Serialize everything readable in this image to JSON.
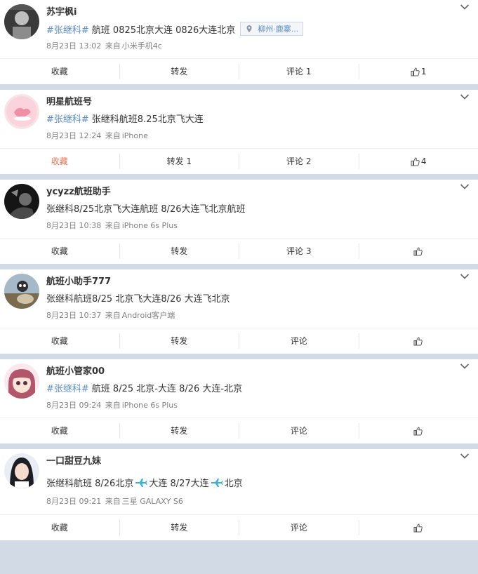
{
  "posts": [
    {
      "username": "苏宇枫i",
      "topic": "#张继科#",
      "text": "航班 0825北京大连 0826大连北京",
      "location": "柳州·鹿寨...",
      "time": "8月23日 13:02",
      "source_prefix": "来自",
      "source": "小米手机4c",
      "actions": {
        "fav": "收藏",
        "repost": "转发",
        "comment": "评论 1",
        "like": "1"
      }
    },
    {
      "username": "明星航班号",
      "topic": "#张继科#",
      "text": "张继科航班8.25北京飞大连",
      "time": "8月23日 12:24",
      "source_prefix": "来自",
      "source": "iPhone",
      "actions": {
        "fav": "收藏",
        "repost": "转发 1",
        "comment": "评论 2",
        "like": "4"
      },
      "fav_active": true
    },
    {
      "username": "ycyzz航班助手",
      "text": "张继科8/25北京飞大连航班 8/26大连飞北京航班",
      "time": "8月23日 10:38",
      "source_prefix": "来自",
      "source": "iPhone 6s Plus",
      "actions": {
        "fav": "收藏",
        "repost": "转发",
        "comment": "评论 3",
        "like": ""
      }
    },
    {
      "username": "航班小助手777",
      "text": "张继科航班8/25 北京飞大连8/26 大连飞北京",
      "time": "8月23日 10:37",
      "source_prefix": "来自",
      "source": "Android客户端",
      "actions": {
        "fav": "收藏",
        "repost": "转发",
        "comment": "评论",
        "like": ""
      }
    },
    {
      "username": "航班小管家00",
      "topic": "#张继科#",
      "text": "航班 8/25 北京-大连 8/26 大连-北京",
      "time": "8月23日 09:24",
      "source_prefix": "来自",
      "source": "iPhone 6s Plus",
      "actions": {
        "fav": "收藏",
        "repost": "转发",
        "comment": "评论",
        "like": ""
      }
    },
    {
      "username": "一口甜豆九妹",
      "text_parts": [
        "张继科航班 8/26北京",
        "大连 8/27大连",
        "北京"
      ],
      "time": "8月23日 09:21",
      "source_prefix": "来自",
      "source": "三星 GALAXY S6",
      "actions": {
        "fav": "收藏",
        "repost": "转发",
        "comment": "评论",
        "like": ""
      }
    }
  ],
  "icons": {
    "more": "chevron-down-icon",
    "like": "thumbs-up-icon",
    "location": "location-pin-icon",
    "plane": "airplane-emoji-icon"
  },
  "colors": {
    "link": "#5b8ec4",
    "active": "#eb7350",
    "meta": "#808080",
    "separator_band": "#d2dbe5"
  }
}
